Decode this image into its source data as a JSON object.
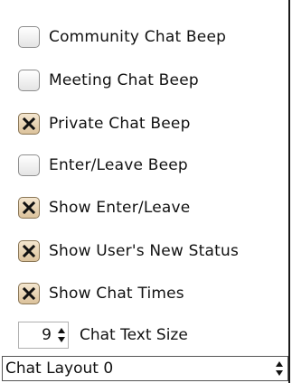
{
  "options": [
    {
      "label": "Community Chat Beep",
      "checked": false
    },
    {
      "label": "Meeting Chat Beep",
      "checked": false
    },
    {
      "label": "Private Chat Beep",
      "checked": true
    },
    {
      "label": "Enter/Leave Beep",
      "checked": false
    },
    {
      "label": "Show Enter/Leave",
      "checked": true
    },
    {
      "label": "Show User's New Status",
      "checked": true
    },
    {
      "label": "Show Chat Times",
      "checked": true
    }
  ],
  "chat_text_size": {
    "value": "9",
    "label": "Chat Text Size"
  },
  "chat_layout": {
    "value": "Chat Layout 0"
  }
}
